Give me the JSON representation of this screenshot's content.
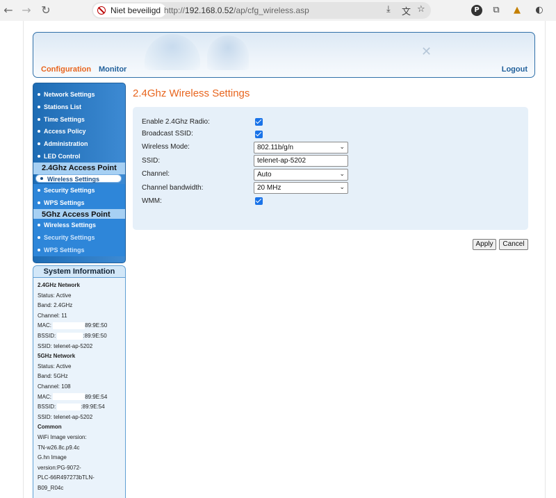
{
  "browser": {
    "security_label": "Niet beveiligd",
    "url_scheme": "http://",
    "url_host": "192.168.0.52",
    "url_path": "/ap/cfg_wireless.asp",
    "profile_initial": "P"
  },
  "header": {
    "tabs": [
      "Configuration",
      "Monitor"
    ],
    "logout": "Logout"
  },
  "sidebar": {
    "items": [
      "Network Settings",
      "Stations List",
      "Time Settings",
      "Access Policy",
      "Administration",
      "LED Control"
    ],
    "section_24": "2.4Ghz Access Point",
    "items_24": [
      "Wireless Settings",
      "Security Settings",
      "WPS Settings"
    ],
    "section_5": "5Ghz Access Point",
    "items_5": [
      "Wireless Settings",
      "Security Settings",
      "WPS Settings"
    ]
  },
  "sysinfo": {
    "title": "System Information",
    "lines": [
      "2.4GHz Network",
      "Status: Active",
      "Band: 2.4GHz",
      "Channel: 11",
      "MAC: ",
      "BSSID: ",
      "SSID: telenet-ap-5202",
      "5GHz Network",
      "Status: Active",
      "Band: 5GHz",
      "Channel: 108",
      "MAC: ",
      "BSSID: ",
      "SSID: telenet-ap-5202",
      "Common",
      "WiFi Image version:",
      "TN-w26.8c.p9.4c",
      "G.hn Image",
      "version:PG-9072-",
      "PLC-66R497273bTLN-",
      "B09_R04c"
    ],
    "mac_24_tail": "89:9E:50",
    "bssid_24_tail": ":89:9E:50",
    "bssid_24_partial": "",
    "mac_5_tail": "89:9E:54",
    "bssid_5_tail": ":89:9E:54"
  },
  "main": {
    "title": "2.4Ghz Wireless Settings",
    "fields": {
      "enable_label": "Enable 2.4Ghz Radio:",
      "enable_checked": true,
      "broadcast_label": "Broadcast SSID:",
      "broadcast_checked": true,
      "mode_label": "Wireless Mode:",
      "mode_value": "802.11b/g/n",
      "ssid_label": "SSID:",
      "ssid_value": "telenet-ap-5202",
      "channel_label": "Channel:",
      "channel_value": "Auto",
      "bandwidth_label": "Channel bandwidth:",
      "bandwidth_value": "20 MHz",
      "wmm_label": "WMM:",
      "wmm_checked": true
    },
    "apply_label": "Apply",
    "cancel_label": "Cancel"
  }
}
